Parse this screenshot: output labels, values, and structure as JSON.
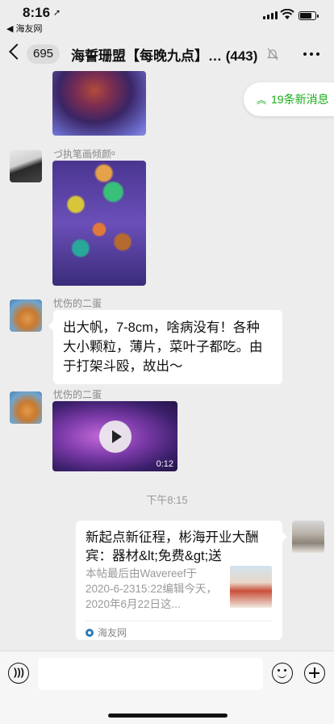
{
  "status_bar": {
    "time": "8:16",
    "location_arrow": "➚",
    "back_app": "◀ 海友网",
    "battery_level": 0.8
  },
  "nav": {
    "unread_count": "695",
    "title": "海誓珊盟【每晚九点】… (443)"
  },
  "new_messages_pill": {
    "chevron": "︽",
    "label": "19条新消息"
  },
  "messages": [
    {
      "type": "image",
      "description_icon": "image"
    },
    {
      "sender": "づ执笔画倾颜ᵅ",
      "type": "image"
    },
    {
      "sender": "忧伤的二蛋",
      "type": "text",
      "text": "出大帆，7-8cm，啥病没有！各种大小颗粒，薄片，菜叶子都吃。由于打架斗殴，故出～"
    },
    {
      "sender": "忧伤的二蛋",
      "type": "video",
      "duration": "0:12"
    }
  ],
  "timestamp": "下午8:15",
  "link_card": {
    "title": "新起点新征程，彬海开业大酬宾：器材&lt;免费&gt;送",
    "description": "本帖最后由Wavereef于2020-6-2315:22编辑今天，2020年6月22日这...",
    "source": "海友网"
  },
  "input_bar": {
    "voice_icon": "voice-icon",
    "emoji_icon": "emoji-icon",
    "plus_icon": "plus-icon"
  }
}
